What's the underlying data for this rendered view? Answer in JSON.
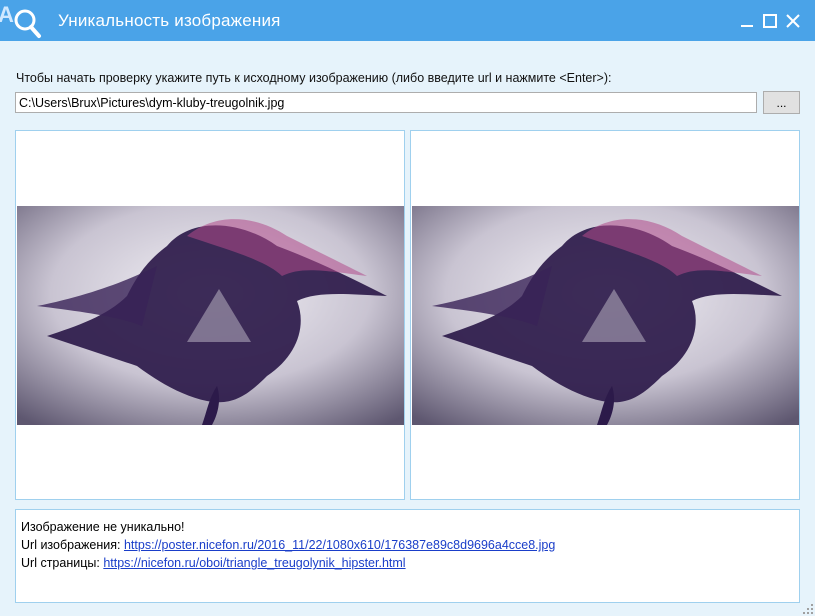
{
  "window": {
    "title": "Уникальность изображения",
    "accent": "#4aa3e8",
    "app_icon": "magnifier-app-icon",
    "controls": [
      "minimize-icon",
      "maximize-icon",
      "close-icon"
    ]
  },
  "input": {
    "prompt": "Чтобы начать проверку укажите путь к исходному изображению (либо введите url и нажмите <Enter>):",
    "value": "C:\\Users\\Brux\\Pictures\\dym-kluby-treugolnik.jpg",
    "browse_label": "..."
  },
  "images": {
    "left": "source-image",
    "right": "found-image",
    "description_icon": "smoke-triangle-image"
  },
  "result": {
    "status": "Изображение не уникально!",
    "image_url_label": "Url изображения:",
    "image_url": "https://poster.nicefon.ru/2016_11/22/1080x610/176387e89c8d9696a4cce8.jpg",
    "page_url_label": "Url страницы:",
    "page_url": "https://nicefon.ru/oboi/triangle_treugolynik_hipster.html"
  }
}
